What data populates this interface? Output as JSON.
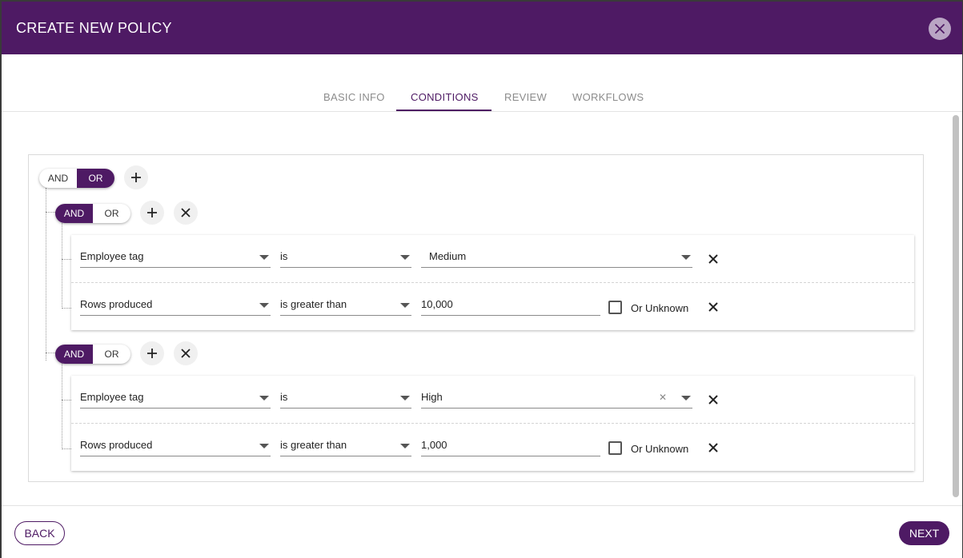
{
  "dialog": {
    "title": "CREATE NEW POLICY"
  },
  "tabs": [
    {
      "label": "BASIC INFO",
      "active": false
    },
    {
      "label": "CONDITIONS",
      "active": true
    },
    {
      "label": "REVIEW",
      "active": false
    },
    {
      "label": "WORKFLOWS",
      "active": false
    }
  ],
  "root": {
    "toggle": {
      "and_label": "AND",
      "or_label": "OR",
      "selected": "OR"
    },
    "groups": [
      {
        "toggle": {
          "and_label": "AND",
          "or_label": "OR",
          "selected": "AND"
        },
        "rules": [
          {
            "field": "Employee tag",
            "operator": "is",
            "value": "Medium",
            "value_type": "select",
            "has_clear": false
          },
          {
            "field": "Rows produced",
            "operator": "is greater than",
            "value": "10,000",
            "value_type": "input",
            "or_unknown_label": "Or Unknown",
            "or_unknown_checked": false
          }
        ]
      },
      {
        "toggle": {
          "and_label": "AND",
          "or_label": "OR",
          "selected": "AND"
        },
        "rules": [
          {
            "field": "Employee tag",
            "operator": "is",
            "value": "High",
            "value_type": "select",
            "has_clear": true
          },
          {
            "field": "Rows produced",
            "operator": "is greater than",
            "value": "1,000",
            "value_type": "input",
            "or_unknown_label": "Or Unknown",
            "or_unknown_checked": false
          }
        ]
      }
    ]
  },
  "footer": {
    "back_label": "BACK",
    "next_label": "NEXT"
  },
  "icons": {
    "close": "close-icon",
    "add": "plus-icon",
    "remove": "close-icon",
    "dropdown": "chevron-down-icon",
    "clear": "clear-icon"
  },
  "colors": {
    "brand": "#4e1a64",
    "close_button": "#b9a5c4"
  }
}
